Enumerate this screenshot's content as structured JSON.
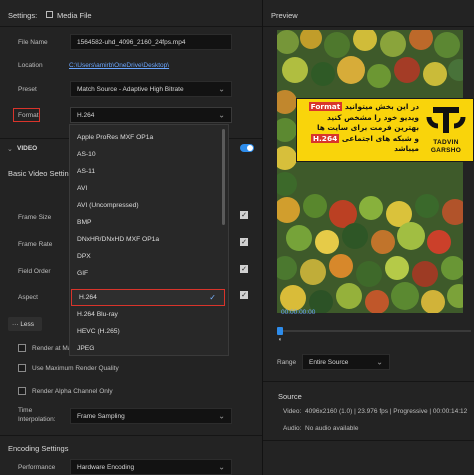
{
  "left": {
    "settings_label": "Settings:",
    "media_file_label": "Media File",
    "file_name": {
      "label": "File Name",
      "value": "1564582-uhd_4096_2160_24fps.mp4"
    },
    "location": {
      "label": "Location",
      "value": "C:\\Users\\amirb\\OneDrive\\Desktop\\"
    },
    "preset": {
      "label": "Preset",
      "value": "Match Source - Adaptive High Bitrate"
    },
    "format": {
      "label": "Format",
      "value": "H.264"
    },
    "video_section": "VIDEO",
    "basic_video_settings": "Basic Video Settings",
    "frame_size": "Frame Size",
    "frame_rate": "Frame Rate",
    "field_order": "Field Order",
    "aspect": "Aspect",
    "less_button": "Less",
    "render_at_max": "Render at Max",
    "use_max_render_quality": "Use Maximum Render Quality",
    "render_alpha": "Render Alpha Channel Only",
    "time_interpolation": {
      "label_line1": "Time",
      "label_line2": "Interpolation:",
      "value": "Frame Sampling"
    },
    "encoding_settings": "Encoding Settings",
    "performance": {
      "label": "Performance",
      "value": "Hardware Encoding"
    }
  },
  "format_dropdown": {
    "options": [
      "Apple ProRes MXF OP1a",
      "AS-10",
      "AS-11",
      "AVI",
      "AVI (Uncompressed)",
      "BMP",
      "DNxHR/DNxHD MXF OP1a",
      "DPX",
      "GIF",
      "H.264",
      "H.264 Blu-ray",
      "HEVC (H.265)",
      "JPEG"
    ],
    "selected": "H.264"
  },
  "right": {
    "preview_label": "Preview",
    "timecode": "00:00:00:00",
    "range": {
      "label": "Range",
      "value": "Entire Source"
    },
    "source_section": "Source",
    "video_info": {
      "label": "Video:",
      "value": "4096x2160 (1.0)  |  23.976 fps  |  Progressive  |  00:00:14:12"
    },
    "audio_info": {
      "label": "Audio:",
      "value": "No audio available"
    }
  },
  "banner": {
    "line1_pre": "در این بخش میتوانید",
    "line1_hl": "Format",
    "line2": "ویدیو خود را مشخص کنید",
    "line3": "بهترین فرمت برای سایت ها",
    "line4_pre": "و شبکه های اجتماعی",
    "line4_hl": "H.264",
    "line5": "میباشد",
    "logo_line1": "TADVIN",
    "logo_line2": "GARSHO"
  },
  "colors": {
    "accent_blue": "#2d8ceb",
    "highlight_red": "#d9342b",
    "banner_yellow": "#f9d40b"
  }
}
